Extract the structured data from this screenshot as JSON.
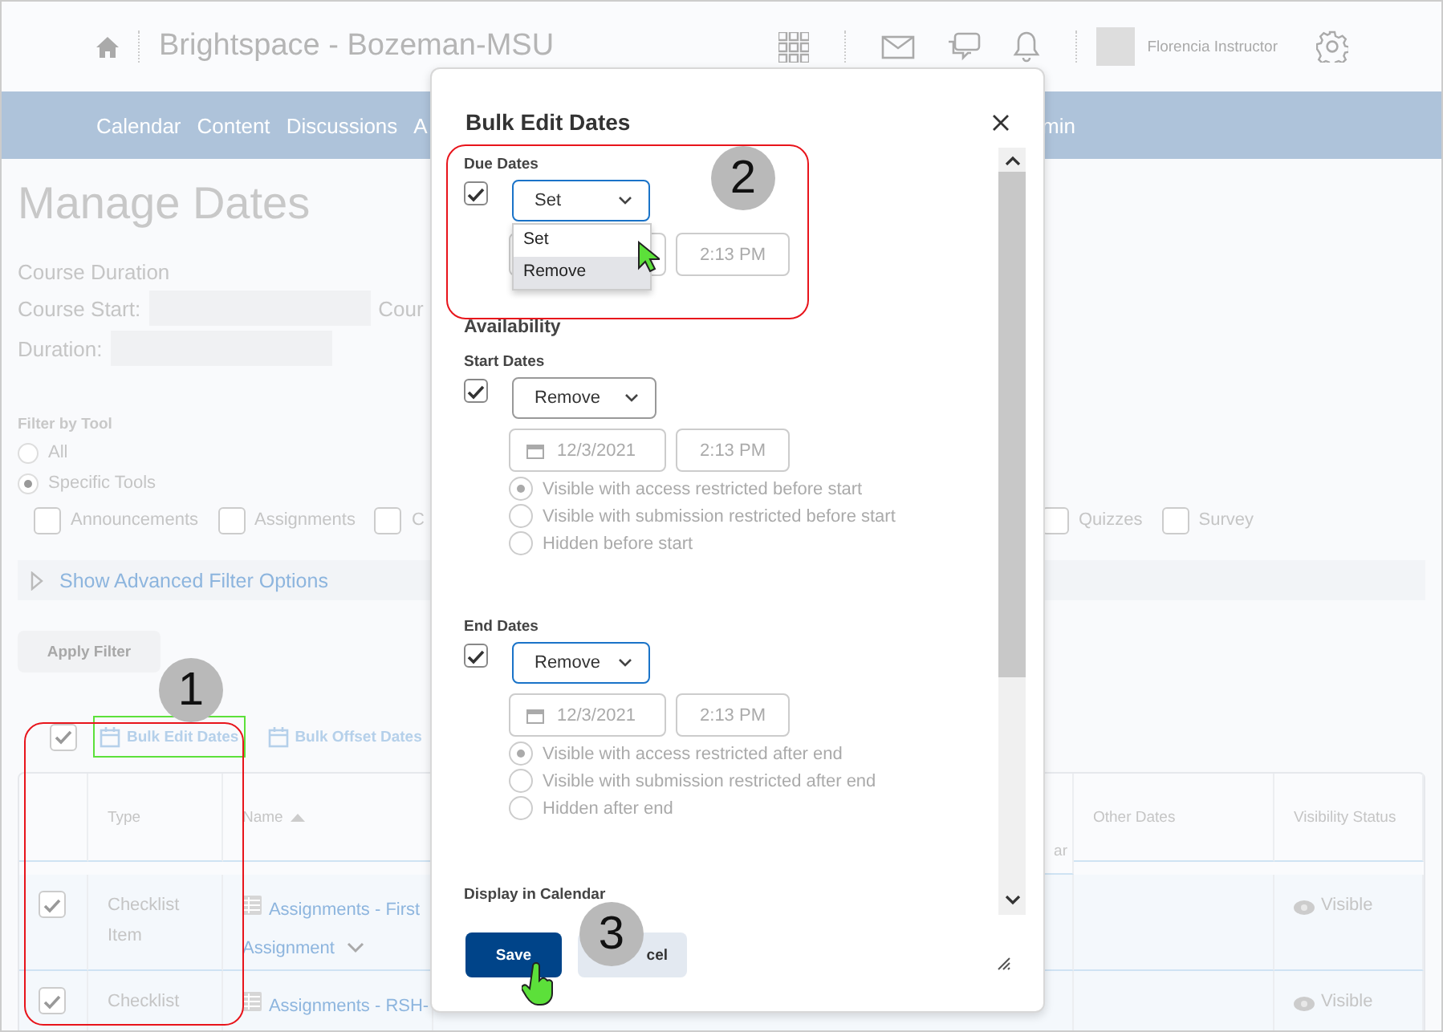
{
  "header": {
    "site_title": "Brightspace - Bozeman-MSU",
    "user_name": "Florencia Instructor"
  },
  "nav": {
    "items_left": [
      "Calendar",
      "Content",
      "Discussions",
      "A"
    ],
    "items_right": [
      "min"
    ]
  },
  "page": {
    "title": "Manage Dates",
    "course_duration_label": "Course Duration",
    "course_start_label": "Course Start:",
    "course_end_label": "Cour",
    "duration_label": "Duration:"
  },
  "filter": {
    "label": "Filter by Tool",
    "scope": [
      {
        "label": "All",
        "selected": false
      },
      {
        "label": "Specific Tools",
        "selected": true
      }
    ],
    "tools_left": [
      {
        "label": "Announcements",
        "checked": false
      },
      {
        "label": "Assignments",
        "checked": false
      },
      {
        "label": "C",
        "checked": false
      }
    ],
    "tools_right": [
      {
        "label": "Quizzes",
        "checked": false
      },
      {
        "label": "Survey",
        "checked": false
      }
    ],
    "advanced_toggle": "Show Advanced Filter Options",
    "apply_button": "Apply Filter"
  },
  "toolbar": {
    "select_all_checked": true,
    "actions": [
      {
        "label": "Bulk Edit Dates",
        "highlighted": true
      },
      {
        "label": "Bulk Offset Dates",
        "highlighted": false
      }
    ]
  },
  "table": {
    "columns": {
      "type": "Type",
      "name": "Name",
      "column_4": "ar",
      "other_dates": "Other Dates",
      "visibility": "Visibility Status"
    },
    "rows": [
      {
        "checked": true,
        "type": "Checklist Item",
        "name": "Assignments - First Assignment",
        "expandable": true,
        "visibility": "Visible"
      },
      {
        "checked": true,
        "type": "Checklist",
        "name": "Assignments - RSH-",
        "expandable": false,
        "visibility": "Visible"
      }
    ]
  },
  "dialog": {
    "title": "Bulk Edit Dates",
    "due_dates": {
      "label": "Due Dates",
      "checked": true,
      "action": "Set",
      "focused": true,
      "menu": [
        {
          "label": "Set",
          "highlighted": false
        },
        {
          "label": "Remove",
          "highlighted": true
        }
      ],
      "time": "2:13 PM"
    },
    "availability_heading": "Availability",
    "availability": [
      {
        "label": "Start Dates",
        "checked": true,
        "action": "Remove",
        "focused": false,
        "date": "12/3/2021",
        "time": "2:13 PM",
        "options": [
          {
            "label": "Visible with access restricted before start",
            "selected": true
          },
          {
            "label": "Visible with submission restricted before start",
            "selected": false
          },
          {
            "label": "Hidden before start",
            "selected": false
          }
        ]
      },
      {
        "label": "End Dates",
        "checked": true,
        "action": "Remove",
        "focused": true,
        "date": "12/3/2021",
        "time": "2:13 PM",
        "options": [
          {
            "label": "Visible with access restricted after end",
            "selected": true
          },
          {
            "label": "Visible with submission restricted after end",
            "selected": false
          },
          {
            "label": "Hidden after end",
            "selected": false
          }
        ]
      }
    ],
    "calendar_heading": "Display in Calendar",
    "buttons": [
      {
        "label": "Save",
        "kind": "primary"
      },
      {
        "label": "cel",
        "kind": "secondary"
      }
    ]
  },
  "annotations": [
    {
      "number": "1"
    },
    {
      "number": "2"
    },
    {
      "number": "3"
    }
  ]
}
